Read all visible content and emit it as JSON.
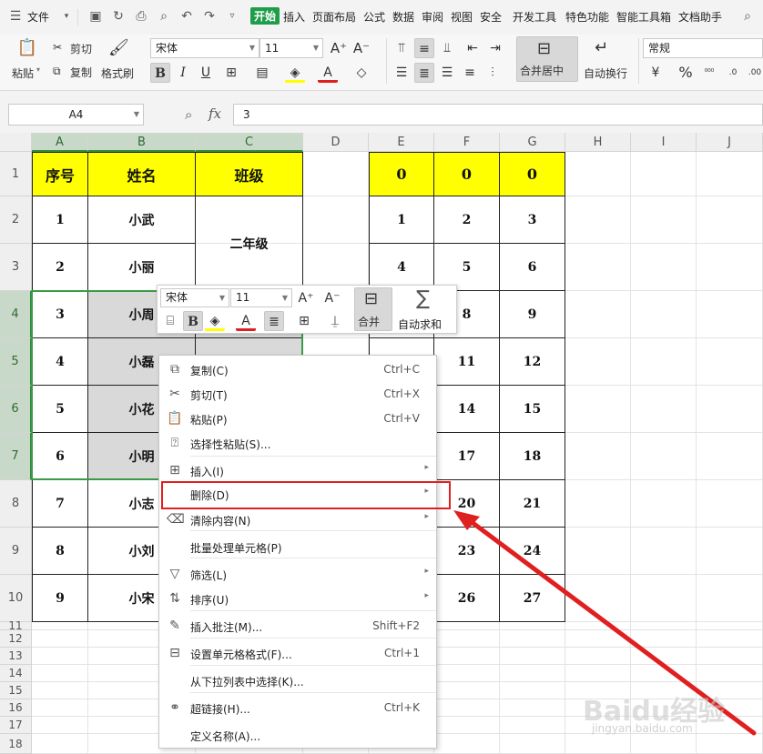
{
  "menubar": {
    "file_label": "文件",
    "tabs": [
      "开始",
      "插入",
      "页面布局",
      "公式",
      "数据",
      "审阅",
      "视图",
      "安全",
      "开发工具",
      "特色功能",
      "智能工具箱",
      "文档助手"
    ],
    "active_tab": "开始"
  },
  "ribbon": {
    "paste": "粘贴",
    "cut": "剪切",
    "copy": "复制",
    "format_painter": "格式刷",
    "font_name": "宋体",
    "font_size": "11",
    "bold": "B",
    "italic": "I",
    "underline": "U",
    "merge_center": "合并居中",
    "wrap_text": "自动换行",
    "number_format": "常规"
  },
  "formula_bar": {
    "cell_ref": "A4",
    "fx": "fx",
    "value": "3"
  },
  "sheet": {
    "columns": [
      "A",
      "B",
      "C",
      "D",
      "E",
      "F",
      "G",
      "H",
      "I",
      "J"
    ],
    "rows": [
      "1",
      "2",
      "3",
      "4",
      "5",
      "6",
      "7",
      "8",
      "9",
      "10",
      "11",
      "12",
      "13",
      "14",
      "15",
      "16",
      "17",
      "18"
    ],
    "table1": {
      "headers": [
        "序号",
        "姓名",
        "班级"
      ],
      "rows": [
        [
          "1",
          "小武"
        ],
        [
          "2",
          "小丽"
        ],
        [
          "3",
          "小周"
        ],
        [
          "4",
          "小磊"
        ],
        [
          "5",
          "小花"
        ],
        [
          "6",
          "小明"
        ],
        [
          "7",
          "小志"
        ],
        [
          "8",
          "小刘"
        ],
        [
          "9",
          "小宋"
        ]
      ],
      "merged_class": "二年级"
    },
    "table2": {
      "rows": [
        [
          "0",
          "0",
          "0"
        ],
        [
          "1",
          "2",
          "3"
        ],
        [
          "4",
          "5",
          "6"
        ],
        [
          "",
          "8",
          "9"
        ],
        [
          "",
          "11",
          "12"
        ],
        [
          "",
          "14",
          "15"
        ],
        [
          "",
          "17",
          "18"
        ],
        [
          "",
          "20",
          "21"
        ],
        [
          "",
          "23",
          "24"
        ],
        [
          "",
          "26",
          "27"
        ]
      ]
    }
  },
  "mini_toolbar": {
    "font_name": "宋体",
    "font_size": "11",
    "bold": "B",
    "merge": "合并",
    "autosum": "自动求和"
  },
  "context_menu": {
    "items": [
      {
        "label": "复制(C)",
        "shortcut": "Ctrl+C",
        "icon": "copy-icon"
      },
      {
        "label": "剪切(T)",
        "shortcut": "Ctrl+X",
        "icon": "scissors-icon"
      },
      {
        "label": "粘贴(P)",
        "shortcut": "Ctrl+V",
        "icon": "paste-icon"
      },
      {
        "label": "选择性粘贴(S)...",
        "shortcut": "",
        "icon": "paste-special-icon"
      },
      {
        "label": "插入(I)",
        "shortcut": "",
        "icon": "insert-icon"
      },
      {
        "label": "删除(D)",
        "shortcut": "",
        "icon": ""
      },
      {
        "label": "清除内容(N)",
        "shortcut": "",
        "icon": "eraser-icon"
      },
      {
        "label": "批量处理单元格(P)",
        "shortcut": "",
        "icon": ""
      },
      {
        "label": "筛选(L)",
        "shortcut": "",
        "icon": "filter-icon"
      },
      {
        "label": "排序(U)",
        "shortcut": "",
        "icon": "sort-icon"
      },
      {
        "label": "插入批注(M)...",
        "shortcut": "Shift+F2",
        "icon": "comment-icon"
      },
      {
        "label": "设置单元格格式(F)...",
        "shortcut": "Ctrl+1",
        "icon": "format-cells-icon"
      },
      {
        "label": "从下拉列表中选择(K)...",
        "shortcut": "",
        "icon": ""
      },
      {
        "label": "超链接(H)...",
        "shortcut": "Ctrl+K",
        "icon": "link-icon"
      },
      {
        "label": "定义名称(A)...",
        "shortcut": "",
        "icon": ""
      }
    ]
  },
  "watermark": {
    "logo": "Baidu经验",
    "url": "jingyan.baidu.com"
  },
  "colors": {
    "accent": "#1f9e4a",
    "header_yellow": "#ffff00",
    "selection_green": "#3a9a46",
    "highlight_red": "#e02020"
  }
}
